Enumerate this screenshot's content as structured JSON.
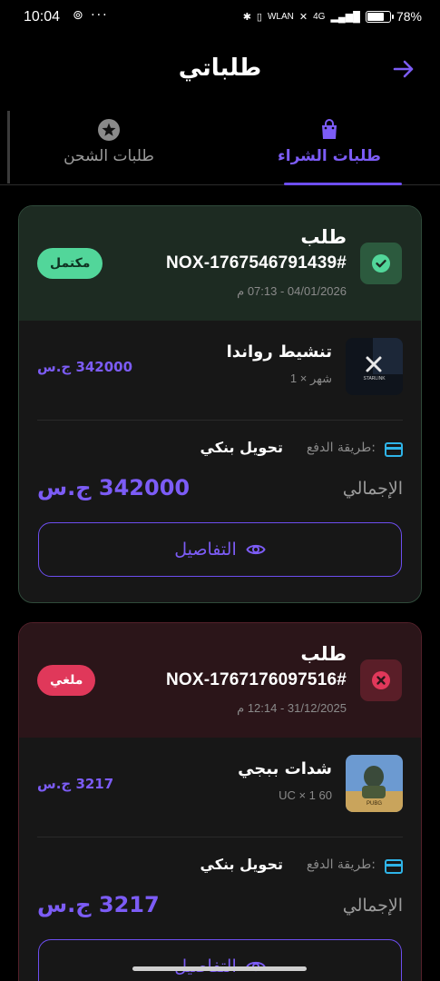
{
  "status_bar": {
    "time": "10:04",
    "left_icons": "⊚ ···",
    "network_label": "WLAN",
    "cell_label": "4G",
    "battery_percent": "78%",
    "battery_level": 0.78
  },
  "header": {
    "title": "طلباتي",
    "back_icon": "arrow-right-icon"
  },
  "tabs": {
    "purchase_label": "طلبات الشراء",
    "shipping_label": "طلبات الشحن",
    "active": "purchase"
  },
  "orders": [
    {
      "word": "طلب",
      "number": "NOX-1767546791439#",
      "date": "04/01/2026 - 07:13 م",
      "status_label": "مكتمل",
      "status": "complete",
      "item_name": "تنشيط رواندا",
      "item_qty": "شهر × 1",
      "item_price": "342000 ج.س",
      "payment_label": "طريقة الدفع:",
      "payment_value": "تحويل بنكي",
      "total_label": "الإجمالي",
      "total_value": "342000 ج.س",
      "details_label": "التفاصيل",
      "thumb_text": "STARLINK"
    },
    {
      "word": "طلب",
      "number": "NOX-1767176097516#",
      "date": "31/12/2025 - 12:14 م",
      "status_label": "ملغي",
      "status": "cancelled",
      "item_name": "شدات ببجي",
      "item_qty": "60 UC × 1",
      "item_price": "3217 ج.س",
      "payment_label": "طريقة الدفع:",
      "payment_value": "تحويل بنكي",
      "total_label": "الإجمالي",
      "total_value": "3217 ج.س",
      "details_label": "التفاصيل",
      "thumb_text": "PUBG"
    }
  ],
  "colors": {
    "accent": "#7c5cf6",
    "complete": "#52d69a",
    "cancelled": "#e0385a",
    "payment_icon": "#2fb4e8"
  }
}
